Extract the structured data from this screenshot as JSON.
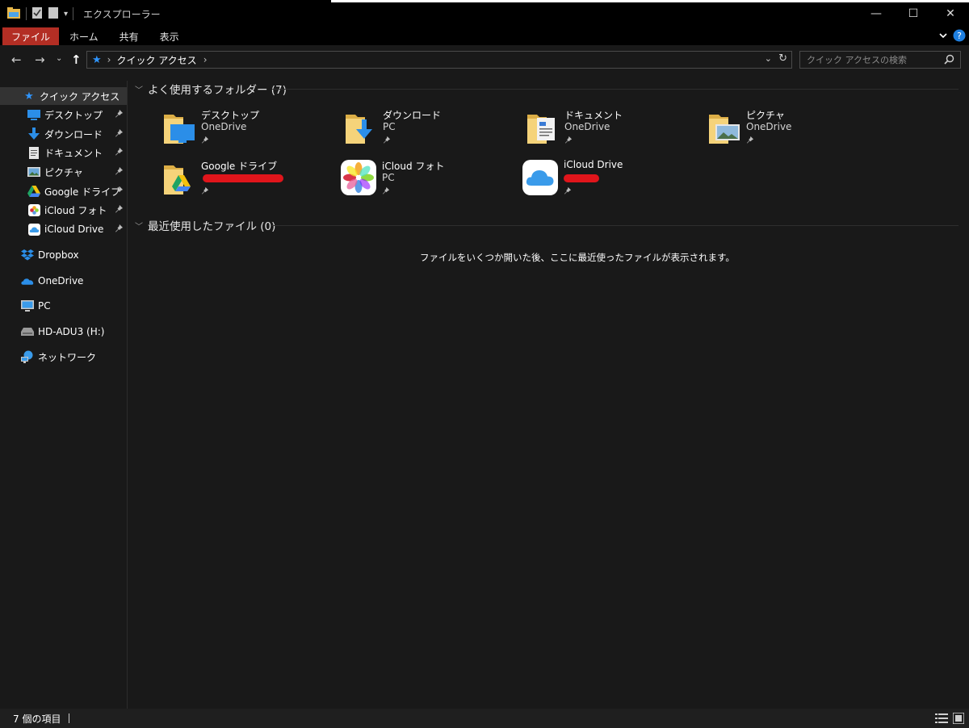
{
  "window": {
    "title": "エクスプローラー",
    "minimize_glyph": "—",
    "maximize_glyph": "☐",
    "close_glyph": "✕"
  },
  "ribbon": {
    "tabs": [
      "ファイル",
      "ホーム",
      "共有",
      "表示"
    ]
  },
  "address": {
    "path_label": "クイック アクセス",
    "separator": "›",
    "search_placeholder": "クイック アクセスの検索"
  },
  "sidebar": {
    "quick_access_label": "クイック アクセス",
    "pinned": [
      {
        "label": "デスクトップ",
        "icon": "desktop-icon"
      },
      {
        "label": "ダウンロード",
        "icon": "download-icon"
      },
      {
        "label": "ドキュメント",
        "icon": "document-icon"
      },
      {
        "label": "ピクチャ",
        "icon": "pictures-icon"
      },
      {
        "label": "Google ドライブ",
        "icon": "google-drive-icon"
      },
      {
        "label": "iCloud フォト",
        "icon": "icloud-photos-icon"
      },
      {
        "label": "iCloud Drive",
        "icon": "icloud-drive-icon"
      }
    ],
    "locations": [
      {
        "label": "Dropbox",
        "icon": "dropbox-icon"
      },
      {
        "label": "OneDrive",
        "icon": "onedrive-icon"
      },
      {
        "label": "PC",
        "icon": "pc-icon"
      },
      {
        "label": "HD-ADU3 (H:)",
        "icon": "drive-icon"
      },
      {
        "label": "ネットワーク",
        "icon": "network-icon"
      }
    ]
  },
  "main": {
    "frequent_header": "よく使用するフォルダー (7)",
    "recent_header": "最近使用したファイル (0)",
    "empty_message": "ファイルをいくつか開いた後、ここに最近使ったファイルが表示されます。",
    "folders": [
      {
        "name": "デスクトップ",
        "location": "OneDrive",
        "icon": "desktop-folder-icon"
      },
      {
        "name": "ダウンロード",
        "location": "PC",
        "icon": "download-folder-icon"
      },
      {
        "name": "ドキュメント",
        "location": "OneDrive",
        "icon": "documents-folder-icon"
      },
      {
        "name": "ピクチャ",
        "location": "OneDrive",
        "icon": "pictures-folder-icon"
      },
      {
        "name": "Google ドライブ",
        "location": "",
        "icon": "google-drive-folder-icon"
      },
      {
        "name": "iCloud フォト",
        "location": "PC",
        "icon": "icloud-photos-icon"
      },
      {
        "name": "iCloud Drive",
        "location": "",
        "icon": "icloud-drive-icon"
      }
    ]
  },
  "status": {
    "item_count": "7 個の項目"
  },
  "colors": {
    "file_tab": "#b32e24",
    "accent_blue": "#1e90ff",
    "folder_yellow": "#f5d37a",
    "redaction": "#e0151b"
  }
}
